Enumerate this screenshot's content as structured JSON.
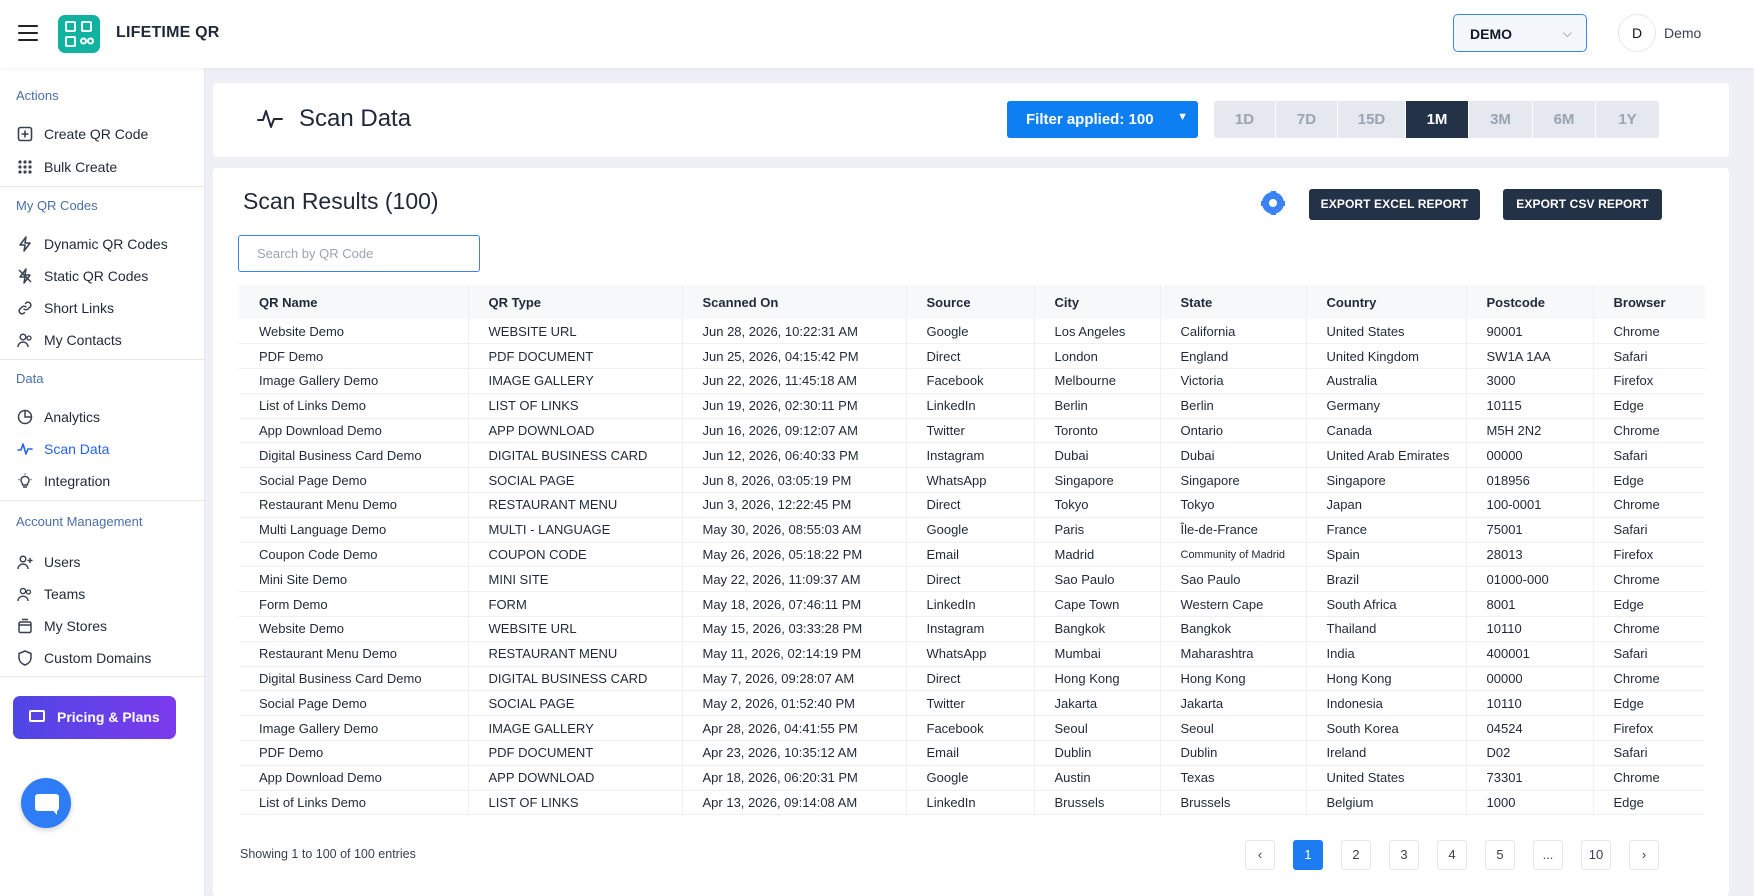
{
  "header": {
    "app_title": "LIFETIME QR",
    "workspace": "DEMO",
    "avatar_initial": "D",
    "user_name": "Demo"
  },
  "sidebar": {
    "sections": [
      "Actions",
      "My QR Codes",
      "Data",
      "Account Management"
    ],
    "items": [
      {
        "label": "Create QR Code",
        "icon": "plus-square-icon"
      },
      {
        "label": "Bulk Create",
        "icon": "grid-dots-icon"
      },
      {
        "label": "Dynamic QR Codes",
        "icon": "lightning-icon"
      },
      {
        "label": "Static QR Codes",
        "icon": "lightning-off-icon"
      },
      {
        "label": "Short Links",
        "icon": "link-icon"
      },
      {
        "label": "My Contacts",
        "icon": "contacts-icon"
      },
      {
        "label": "Analytics",
        "icon": "pie-chart-icon"
      },
      {
        "label": "Scan Data",
        "icon": "activity-icon"
      },
      {
        "label": "Integration",
        "icon": "bulb-icon"
      },
      {
        "label": "Users",
        "icon": "user-plus-icon"
      },
      {
        "label": "Teams",
        "icon": "team-icon"
      },
      {
        "label": "My Stores",
        "icon": "store-icon"
      },
      {
        "label": "Custom Domains",
        "icon": "shield-icon"
      }
    ],
    "pricing_label": "Pricing & Plans"
  },
  "page": {
    "title": "Scan Data",
    "filter_label": "Filter applied: 100",
    "ranges": [
      "1D",
      "7D",
      "15D",
      "1M",
      "3M",
      "6M",
      "1Y"
    ],
    "active_range": "1M"
  },
  "results": {
    "title": "Scan Results (100)",
    "export_excel": "EXPORT EXCEL REPORT",
    "export_csv": "EXPORT CSV REPORT",
    "search_placeholder": "Search by QR Code",
    "columns": [
      "QR Name",
      "QR Type",
      "Scanned On",
      "Source",
      "City",
      "State",
      "Country",
      "Postcode",
      "Browser"
    ],
    "rows": [
      [
        "Website Demo",
        "WEBSITE URL",
        "Jun 28, 2026, 10:22:31 AM",
        "Google",
        "Los Angeles",
        "California",
        "United States",
        "90001",
        "Chrome"
      ],
      [
        "PDF Demo",
        "PDF DOCUMENT",
        "Jun 25, 2026, 04:15:42 PM",
        "Direct",
        "London",
        "England",
        "United Kingdom",
        "SW1A 1AA",
        "Safari"
      ],
      [
        "Image Gallery Demo",
        "IMAGE GALLERY",
        "Jun 22, 2026, 11:45:18 AM",
        "Facebook",
        "Melbourne",
        "Victoria",
        "Australia",
        "3000",
        "Firefox"
      ],
      [
        "List of Links Demo",
        "LIST OF LINKS",
        "Jun 19, 2026, 02:30:11 PM",
        "LinkedIn",
        "Berlin",
        "Berlin",
        "Germany",
        "10115",
        "Edge"
      ],
      [
        "App Download Demo",
        "APP DOWNLOAD",
        "Jun 16, 2026, 09:12:07 AM",
        "Twitter",
        "Toronto",
        "Ontario",
        "Canada",
        "M5H 2N2",
        "Chrome"
      ],
      [
        "Digital Business Card Demo",
        "DIGITAL BUSINESS CARD",
        "Jun 12, 2026, 06:40:33 PM",
        "Instagram",
        "Dubai",
        "Dubai",
        "United Arab Emirates",
        "00000",
        "Safari"
      ],
      [
        "Social Page Demo",
        "SOCIAL PAGE",
        "Jun 8, 2026, 03:05:19 PM",
        "WhatsApp",
        "Singapore",
        "Singapore",
        "Singapore",
        "018956",
        "Edge"
      ],
      [
        "Restaurant Menu Demo",
        "RESTAURANT MENU",
        "Jun 3, 2026, 12:22:45 PM",
        "Direct",
        "Tokyo",
        "Tokyo",
        "Japan",
        "100-0001",
        "Chrome"
      ],
      [
        "Multi Language Demo",
        "MULTI - LANGUAGE",
        "May 30, 2026, 08:55:03 AM",
        "Google",
        "Paris",
        "Île-de-France",
        "France",
        "75001",
        "Safari"
      ],
      [
        "Coupon Code Demo",
        "COUPON CODE",
        "May 26, 2026, 05:18:22 PM",
        "Email",
        "Madrid",
        "Community of Madrid",
        "Spain",
        "28013",
        "Firefox"
      ],
      [
        "Mini Site Demo",
        "MINI SITE",
        "May 22, 2026, 11:09:37 AM",
        "Direct",
        "Sao Paulo",
        "Sao Paulo",
        "Brazil",
        "01000-000",
        "Chrome"
      ],
      [
        "Form Demo",
        "FORM",
        "May 18, 2026, 07:46:11 PM",
        "LinkedIn",
        "Cape Town",
        "Western Cape",
        "South Africa",
        "8001",
        "Edge"
      ],
      [
        "Website Demo",
        "WEBSITE URL",
        "May 15, 2026, 03:33:28 PM",
        "Instagram",
        "Bangkok",
        "Bangkok",
        "Thailand",
        "10110",
        "Chrome"
      ],
      [
        "Restaurant Menu Demo",
        "RESTAURANT MENU",
        "May 11, 2026, 02:14:19 PM",
        "WhatsApp",
        "Mumbai",
        "Maharashtra",
        "India",
        "400001",
        "Safari"
      ],
      [
        "Digital Business Card Demo",
        "DIGITAL BUSINESS CARD",
        "May 7, 2026, 09:28:07 AM",
        "Direct",
        "Hong Kong",
        "Hong Kong",
        "Hong Kong",
        "00000",
        "Chrome"
      ],
      [
        "Social Page Demo",
        "SOCIAL PAGE",
        "May 2, 2026, 01:52:40 PM",
        "Twitter",
        "Jakarta",
        "Jakarta",
        "Indonesia",
        "10110",
        "Edge"
      ],
      [
        "Image Gallery Demo",
        "IMAGE GALLERY",
        "Apr 28, 2026, 04:41:55 PM",
        "Facebook",
        "Seoul",
        "Seoul",
        "South Korea",
        "04524",
        "Firefox"
      ],
      [
        "PDF Demo",
        "PDF DOCUMENT",
        "Apr 23, 2026, 10:35:12 AM",
        "Email",
        "Dublin",
        "Dublin",
        "Ireland",
        "D02",
        "Safari"
      ],
      [
        "App Download Demo",
        "APP DOWNLOAD",
        "Apr 18, 2026, 06:20:31 PM",
        "Google",
        "Austin",
        "Texas",
        "United States",
        "73301",
        "Chrome"
      ],
      [
        "List of Links Demo",
        "LIST OF LINKS",
        "Apr 13, 2026, 09:14:08 AM",
        "LinkedIn",
        "Brussels",
        "Brussels",
        "Belgium",
        "1000",
        "Edge"
      ]
    ],
    "showing_text": "Showing 1 to 100 of 100 entries",
    "pagination": [
      "‹",
      "1",
      "2",
      "3",
      "4",
      "5",
      "...",
      "10",
      "›"
    ],
    "current_page": "1"
  },
  "colors": {
    "primary": "#0d7ff2",
    "dark": "#243248",
    "brand": "#10b3a0",
    "active_nav": "#2563eb"
  }
}
